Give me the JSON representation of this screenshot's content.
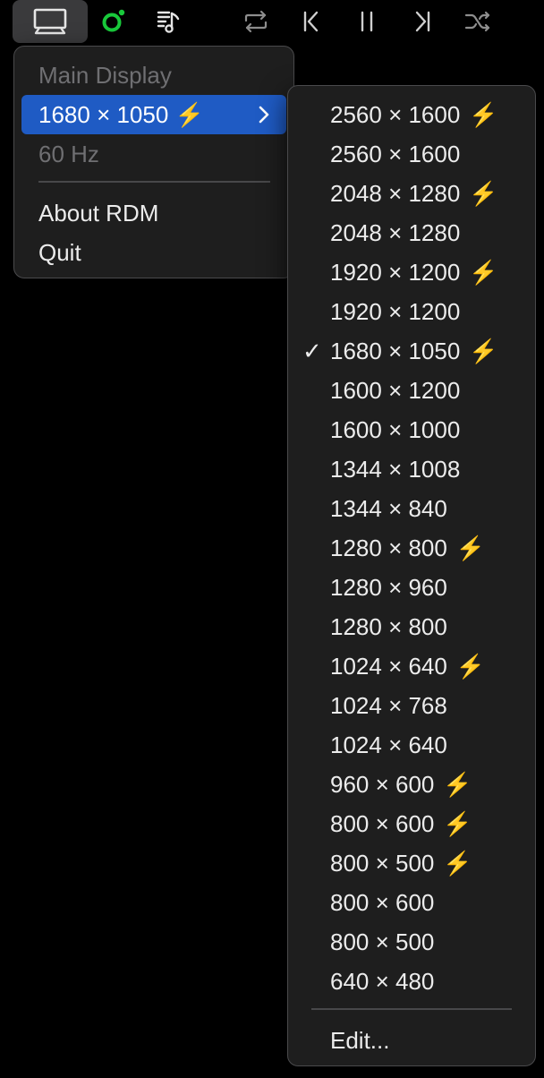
{
  "menubar": {
    "icons": [
      "display-icon",
      "circle-record-icon",
      "music-list-icon",
      "repeat-icon",
      "previous-track-icon",
      "pause-icon",
      "next-track-icon",
      "shuffle-icon"
    ],
    "accent_green": "#19c93b"
  },
  "main_menu": {
    "header": "Main Display",
    "current_resolution": "1680 × 1050 ⚡",
    "refresh_rate": "60 Hz",
    "about": "About RDM",
    "quit": "Quit",
    "highlight_color": "#1f5bc4"
  },
  "resolutions": [
    {
      "label": "2560 × 1600",
      "hidpi": true,
      "checked": false
    },
    {
      "label": "2560 × 1600",
      "hidpi": false,
      "checked": false
    },
    {
      "label": "2048 × 1280",
      "hidpi": true,
      "checked": false
    },
    {
      "label": "2048 × 1280",
      "hidpi": false,
      "checked": false
    },
    {
      "label": "1920 × 1200",
      "hidpi": true,
      "checked": false
    },
    {
      "label": "1920 × 1200",
      "hidpi": false,
      "checked": false
    },
    {
      "label": "1680 × 1050",
      "hidpi": true,
      "checked": true
    },
    {
      "label": "1600 × 1200",
      "hidpi": false,
      "checked": false
    },
    {
      "label": "1600 × 1000",
      "hidpi": false,
      "checked": false
    },
    {
      "label": "1344 × 1008",
      "hidpi": false,
      "checked": false
    },
    {
      "label": "1344 × 840",
      "hidpi": false,
      "checked": false
    },
    {
      "label": "1280 × 800",
      "hidpi": true,
      "checked": false
    },
    {
      "label": "1280 × 960",
      "hidpi": false,
      "checked": false
    },
    {
      "label": "1280 × 800",
      "hidpi": false,
      "checked": false
    },
    {
      "label": "1024 × 640",
      "hidpi": true,
      "checked": false
    },
    {
      "label": "1024 × 768",
      "hidpi": false,
      "checked": false
    },
    {
      "label": "1024 × 640",
      "hidpi": false,
      "checked": false
    },
    {
      "label": "960 × 600",
      "hidpi": true,
      "checked": false
    },
    {
      "label": "800 × 600",
      "hidpi": true,
      "checked": false
    },
    {
      "label": "800 × 500",
      "hidpi": true,
      "checked": false
    },
    {
      "label": "800 × 600",
      "hidpi": false,
      "checked": false
    },
    {
      "label": "800 × 500",
      "hidpi": false,
      "checked": false
    },
    {
      "label": "640 × 480",
      "hidpi": false,
      "checked": false
    }
  ],
  "bolt_glyph": "⚡",
  "check_glyph": "✓",
  "edit_label": "Edit..."
}
